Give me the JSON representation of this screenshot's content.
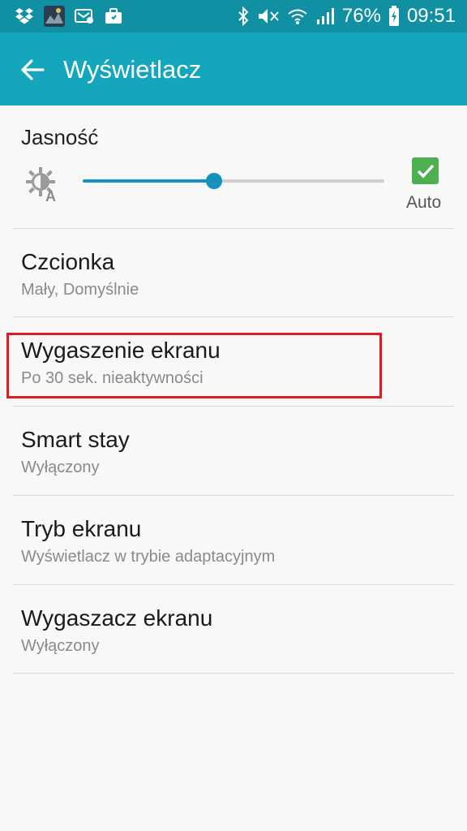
{
  "status_bar": {
    "left_icons": [
      "dropbox-icon",
      "game-thumbnail-icon",
      "email-notification-icon",
      "briefcase-icon"
    ],
    "right_icons": [
      "bluetooth-icon",
      "mute-icon",
      "wifi-icon",
      "signal-icon",
      "battery-charging-icon"
    ],
    "battery": "76%",
    "time": "09:51"
  },
  "app_bar": {
    "title": "Wyświetlacz",
    "background": "#14a6bd"
  },
  "brightness": {
    "label": "Jasność",
    "level": 0.435,
    "auto_checked": true,
    "auto_label": "Auto"
  },
  "settings": [
    {
      "title": "Czcionka",
      "subtitle": "Mały, Domyślnie",
      "highlighted": false
    },
    {
      "title": "Wygaszenie ekranu",
      "subtitle": "Po 30 sek. nieaktywności",
      "highlighted": true
    },
    {
      "title": "Smart stay",
      "subtitle": "Wyłączony",
      "highlighted": false
    },
    {
      "title": "Tryb ekranu",
      "subtitle": "Wyświetlacz w trybie adaptacyjnym",
      "highlighted": false
    },
    {
      "title": "Wygaszacz ekranu",
      "subtitle": "Wyłączony",
      "highlighted": false
    }
  ],
  "colors": {
    "status_bar": "#118fa3",
    "accent": "#1493bf",
    "checkbox": "#4caf50",
    "highlight": "#e01b24"
  }
}
